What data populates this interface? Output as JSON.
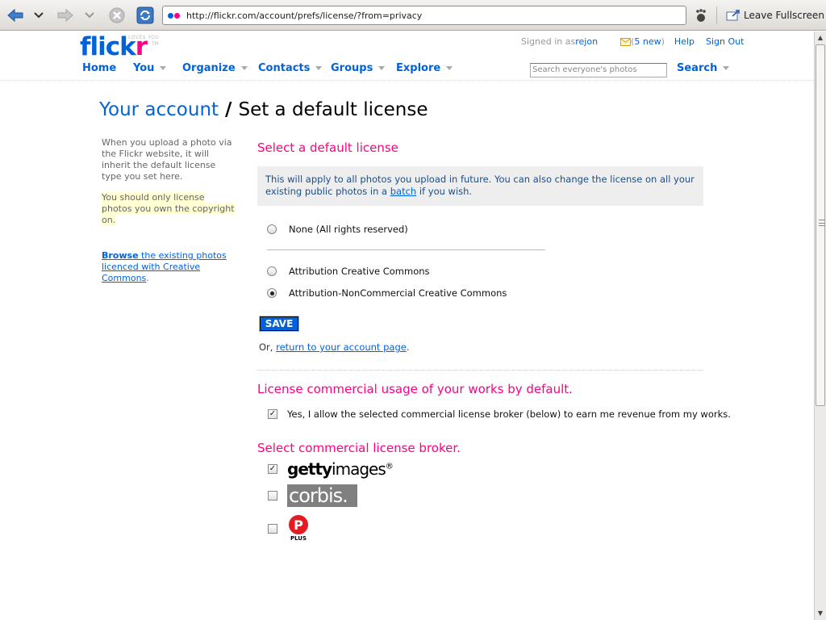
{
  "browser": {
    "url": "http://flickr.com/account/prefs/license/?from=privacy",
    "leave_fullscreen": "Leave Fullscreen"
  },
  "header": {
    "logo_blue": "flick",
    "logo_pink": "r",
    "logo_tagline": "LOVES YOU",
    "logo_tm": "TM",
    "signed_in_prefix": "Signed in as ",
    "user": "rejon",
    "mail_open": " (",
    "mail_count": "5 new",
    "mail_close": ")",
    "help": "Help",
    "sign_out": "Sign Out",
    "search_placeholder": "Search everyone's photos",
    "search_label": "Search"
  },
  "nav": {
    "home": "Home",
    "you": "You",
    "organize": "Organize",
    "contacts": "Contacts",
    "groups": "Groups",
    "explore": "Explore"
  },
  "title": {
    "account": "Your account",
    "slash": " / ",
    "current": "Set a default license"
  },
  "sidebar": {
    "intro": "When you upload a photo via the Flickr website, it will inherit the default license type you set here.",
    "warning": "You should only license photos you own the copyright on.",
    "browse_bold": "Browse",
    "browse_rest": " the existing photos licenced with Creative Commons",
    "browse_end": "."
  },
  "main": {
    "select_heading": "Select a default license",
    "info_pre": "This will apply to all photos you upload in future. You can also change the license on all your existing public photos in a ",
    "info_link": "batch",
    "info_post": " if you wish.",
    "license_options": [
      {
        "label": "None (All rights reserved)",
        "selected": false
      },
      {
        "label": "Attribution Creative Commons",
        "selected": false
      },
      {
        "label": "Attribution-NonCommercial Creative Commons",
        "selected": true
      }
    ],
    "save": "SAVE",
    "return_pre": "Or, ",
    "return_link": "return to your account page",
    "return_post": ".",
    "commercial_heading": "License commercial usage of your works by default.",
    "commercial_checkbox": "Yes, I allow the selected commercial license broker (below) to earn me revenue from my works.",
    "commercial_checked": true,
    "broker_heading": "Select commercial license broker.",
    "brokers": [
      {
        "name_bold": "getty",
        "name_rest": "images",
        "mark": "®",
        "checked": true
      },
      {
        "name": "corbis.",
        "checked": false
      },
      {
        "symbol": "P",
        "name": "PLUS",
        "checked": false
      }
    ]
  },
  "colors": {
    "flickr_blue": "#0063dc",
    "flickr_pink": "#ff0084"
  }
}
